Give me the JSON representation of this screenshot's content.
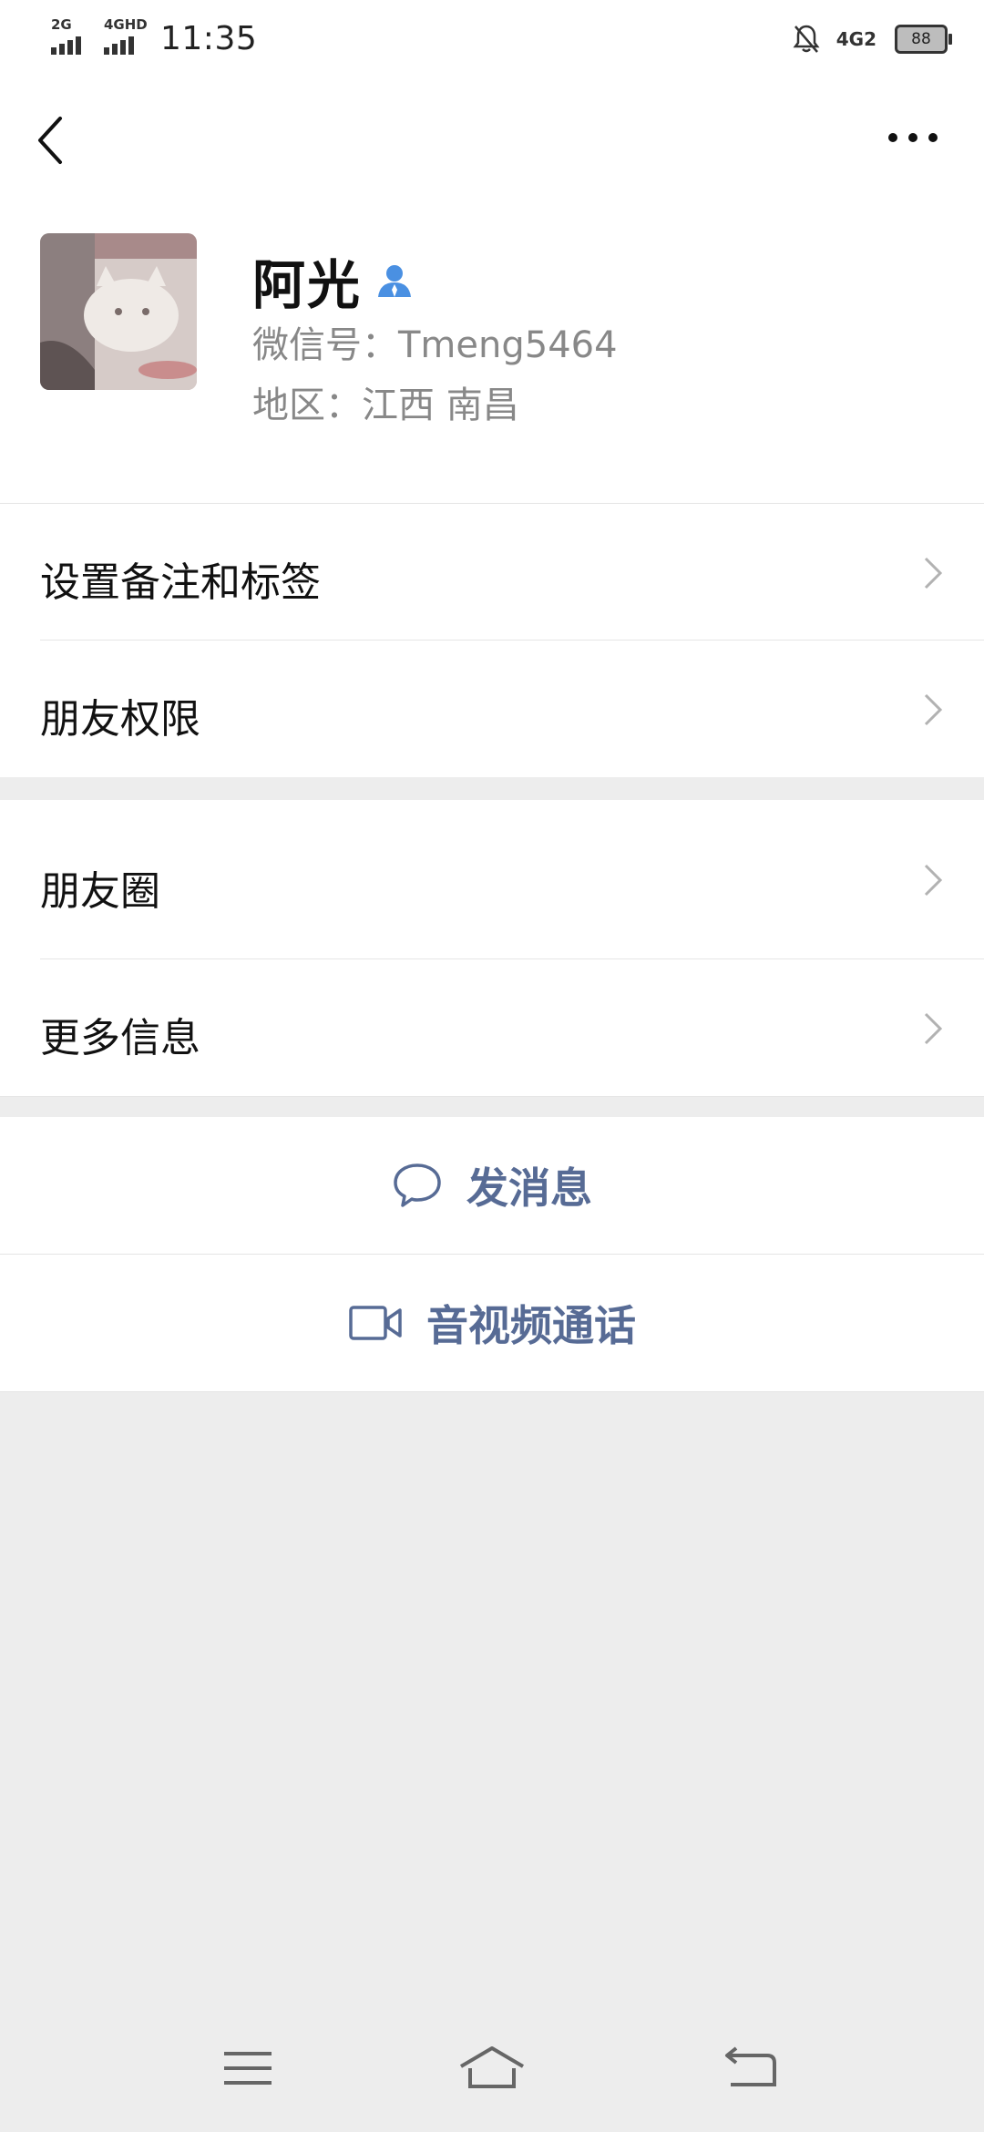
{
  "status_bar": {
    "sim1_label": "2G",
    "sim2_label": "4GHD",
    "time": "11:35",
    "network": "4G2",
    "battery": "88"
  },
  "profile": {
    "name": "阿光",
    "wechat_id": "微信号：Tmeng5464",
    "region": "地区：江西  南昌"
  },
  "menu": {
    "group1": [
      {
        "label": "设置备注和标签"
      },
      {
        "label": "朋友权限"
      }
    ],
    "group2": [
      {
        "label": "朋友圈"
      },
      {
        "label": "更多信息"
      }
    ]
  },
  "actions": {
    "send_message": "发消息",
    "video_call": "音视频通话"
  },
  "colors": {
    "accent": "#576b95",
    "background": "#ededed",
    "contact_icon": "#4a90e2"
  },
  "icons": {
    "back": "back-chevron-icon",
    "more": "more-dots-icon",
    "chat": "chat-bubble-icon",
    "video": "video-camera-icon"
  }
}
